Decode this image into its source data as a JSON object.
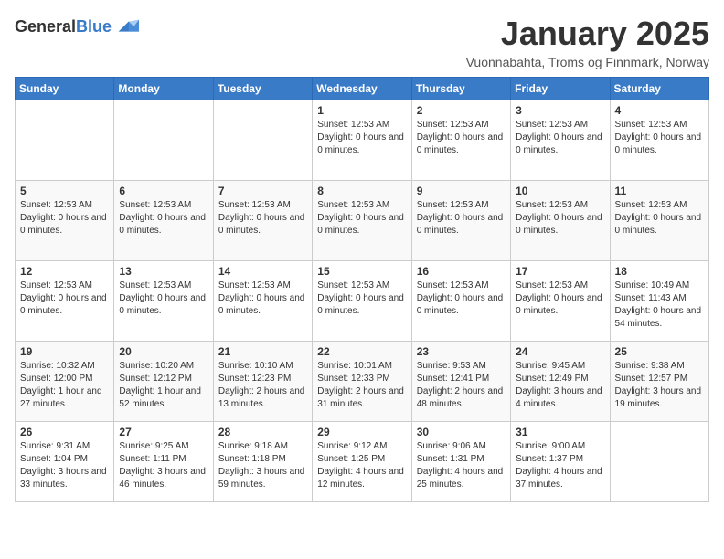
{
  "logo": {
    "general": "General",
    "blue": "Blue"
  },
  "header": {
    "month": "January 2025",
    "location": "Vuonnabahta, Troms og Finnmark, Norway"
  },
  "weekdays": [
    "Sunday",
    "Monday",
    "Tuesday",
    "Wednesday",
    "Thursday",
    "Friday",
    "Saturday"
  ],
  "weeks": [
    [
      {
        "day": "",
        "info": ""
      },
      {
        "day": "",
        "info": ""
      },
      {
        "day": "",
        "info": ""
      },
      {
        "day": "1",
        "info": "Sunset: 12:53 AM\nDaylight: 0 hours and 0 minutes."
      },
      {
        "day": "2",
        "info": "Sunset: 12:53 AM\nDaylight: 0 hours and 0 minutes."
      },
      {
        "day": "3",
        "info": "Sunset: 12:53 AM\nDaylight: 0 hours and 0 minutes."
      },
      {
        "day": "4",
        "info": "Sunset: 12:53 AM\nDaylight: 0 hours and 0 minutes."
      }
    ],
    [
      {
        "day": "5",
        "info": "Sunset: 12:53 AM\nDaylight: 0 hours and 0 minutes."
      },
      {
        "day": "6",
        "info": "Sunset: 12:53 AM\nDaylight: 0 hours and 0 minutes."
      },
      {
        "day": "7",
        "info": "Sunset: 12:53 AM\nDaylight: 0 hours and 0 minutes."
      },
      {
        "day": "8",
        "info": "Sunset: 12:53 AM\nDaylight: 0 hours and 0 minutes."
      },
      {
        "day": "9",
        "info": "Sunset: 12:53 AM\nDaylight: 0 hours and 0 minutes."
      },
      {
        "day": "10",
        "info": "Sunset: 12:53 AM\nDaylight: 0 hours and 0 minutes."
      },
      {
        "day": "11",
        "info": "Sunset: 12:53 AM\nDaylight: 0 hours and 0 minutes."
      }
    ],
    [
      {
        "day": "12",
        "info": "Sunset: 12:53 AM\nDaylight: 0 hours and 0 minutes."
      },
      {
        "day": "13",
        "info": "Sunset: 12:53 AM\nDaylight: 0 hours and 0 minutes."
      },
      {
        "day": "14",
        "info": "Sunset: 12:53 AM\nDaylight: 0 hours and 0 minutes."
      },
      {
        "day": "15",
        "info": "Sunset: 12:53 AM\nDaylight: 0 hours and 0 minutes."
      },
      {
        "day": "16",
        "info": "Sunset: 12:53 AM\nDaylight: 0 hours and 0 minutes."
      },
      {
        "day": "17",
        "info": "Sunset: 12:53 AM\nDaylight: 0 hours and 0 minutes."
      },
      {
        "day": "18",
        "info": "Sunrise: 10:49 AM\nSunset: 11:43 AM\nDaylight: 0 hours and 54 minutes."
      }
    ],
    [
      {
        "day": "19",
        "info": "Sunrise: 10:32 AM\nSunset: 12:00 PM\nDaylight: 1 hour and 27 minutes."
      },
      {
        "day": "20",
        "info": "Sunrise: 10:20 AM\nSunset: 12:12 PM\nDaylight: 1 hour and 52 minutes."
      },
      {
        "day": "21",
        "info": "Sunrise: 10:10 AM\nSunset: 12:23 PM\nDaylight: 2 hours and 13 minutes."
      },
      {
        "day": "22",
        "info": "Sunrise: 10:01 AM\nSunset: 12:33 PM\nDaylight: 2 hours and 31 minutes."
      },
      {
        "day": "23",
        "info": "Sunrise: 9:53 AM\nSunset: 12:41 PM\nDaylight: 2 hours and 48 minutes."
      },
      {
        "day": "24",
        "info": "Sunrise: 9:45 AM\nSunset: 12:49 PM\nDaylight: 3 hours and 4 minutes."
      },
      {
        "day": "25",
        "info": "Sunrise: 9:38 AM\nSunset: 12:57 PM\nDaylight: 3 hours and 19 minutes."
      }
    ],
    [
      {
        "day": "26",
        "info": "Sunrise: 9:31 AM\nSunset: 1:04 PM\nDaylight: 3 hours and 33 minutes."
      },
      {
        "day": "27",
        "info": "Sunrise: 9:25 AM\nSunset: 1:11 PM\nDaylight: 3 hours and 46 minutes."
      },
      {
        "day": "28",
        "info": "Sunrise: 9:18 AM\nSunset: 1:18 PM\nDaylight: 3 hours and 59 minutes."
      },
      {
        "day": "29",
        "info": "Sunrise: 9:12 AM\nSunset: 1:25 PM\nDaylight: 4 hours and 12 minutes."
      },
      {
        "day": "30",
        "info": "Sunrise: 9:06 AM\nSunset: 1:31 PM\nDaylight: 4 hours and 25 minutes."
      },
      {
        "day": "31",
        "info": "Sunrise: 9:00 AM\nSunset: 1:37 PM\nDaylight: 4 hours and 37 minutes."
      },
      {
        "day": "",
        "info": ""
      }
    ]
  ]
}
